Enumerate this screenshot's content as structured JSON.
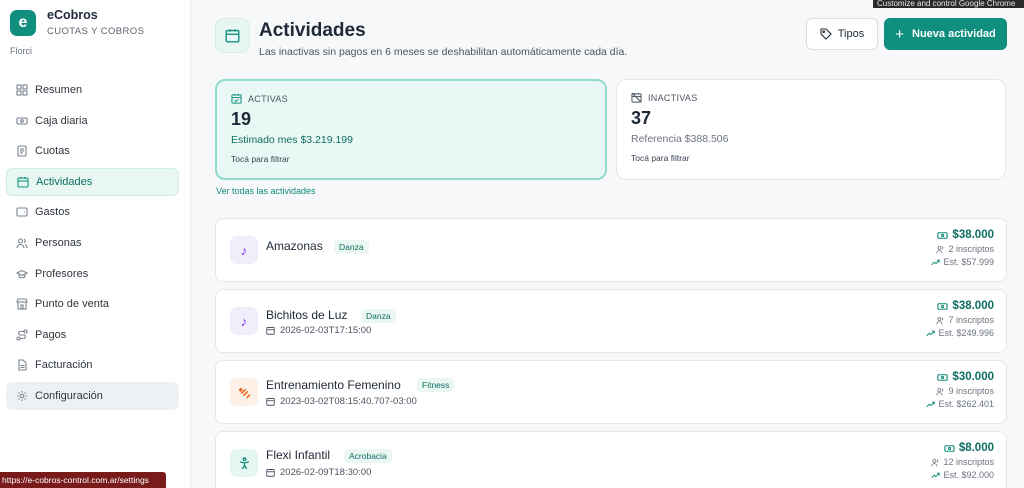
{
  "app": {
    "name": "eCobros",
    "subtitle": "CUOTAS Y COBROS",
    "logo_letter": "e",
    "user": "Florci"
  },
  "sidebar": {
    "items": [
      {
        "label": "Resumen",
        "icon": "grid-icon"
      },
      {
        "label": "Caja diaria",
        "icon": "cash-icon"
      },
      {
        "label": "Cuotas",
        "icon": "receipt-icon"
      },
      {
        "label": "Actividades",
        "icon": "calendar-icon",
        "active": true
      },
      {
        "label": "Gastos",
        "icon": "wallet-icon"
      },
      {
        "label": "Personas",
        "icon": "users-icon"
      },
      {
        "label": "Profesores",
        "icon": "graduation-cap-icon"
      },
      {
        "label": "Punto de venta",
        "icon": "store-icon"
      },
      {
        "label": "Pagos",
        "icon": "route-icon"
      },
      {
        "label": "Facturación",
        "icon": "document-icon"
      },
      {
        "label": "Configuración",
        "icon": "gear-icon",
        "hovered": true
      }
    ]
  },
  "header": {
    "title": "Actividades",
    "subtitle": "Las inactivas sin pagos en 6 meses se deshabilitan automáticamente cada día.",
    "tipos_label": "Tipos",
    "nueva_label": "Nueva actividad",
    "tooltip": "Customize and control Google Chrome"
  },
  "stats": {
    "active": {
      "label": "ACTIVAS",
      "count": "19",
      "estimate": "Estimado mes $3.219.199",
      "hint": "Tocá para filtrar"
    },
    "inactive": {
      "label": "INACTIVAS",
      "count": "37",
      "estimate": "Referencia $388.506",
      "hint": "Tocá para filtrar"
    },
    "view_all": "Ver todas las actividades"
  },
  "activities": [
    {
      "name": "Amazonas",
      "tag": "Danza",
      "date": "",
      "price": "$38.000",
      "inscriptos": "2 inscriptos",
      "est": "Est. $57.999",
      "icon": "music-note-icon"
    },
    {
      "name": "Bichitos de Luz",
      "tag": "Danza",
      "date": "2026-02-03T17:15:00",
      "price": "$38.000",
      "inscriptos": "7 inscriptos",
      "est": "Est. $249.996",
      "icon": "music-note-icon"
    },
    {
      "name": "Entrenamiento Femenino",
      "tag": "Fitness",
      "date": "2023-03-02T08:15:40.707-03:00",
      "price": "$30.000",
      "inscriptos": "9 inscriptos",
      "est": "Est. $262.401",
      "icon": "dumbbell-icon"
    },
    {
      "name": "Flexi Infantil",
      "tag": "Acrobacia",
      "date": "2026-02-09T18:30:00",
      "price": "$8.000",
      "inscriptos": "12 inscriptos",
      "est": "Est. $92.000",
      "icon": "acrobat-icon"
    }
  ],
  "statusbar": "https://e-cobros-control.com.ar/settings",
  "colors": {
    "accent": "#118f7e",
    "accent_light": "#eaf8f5"
  }
}
